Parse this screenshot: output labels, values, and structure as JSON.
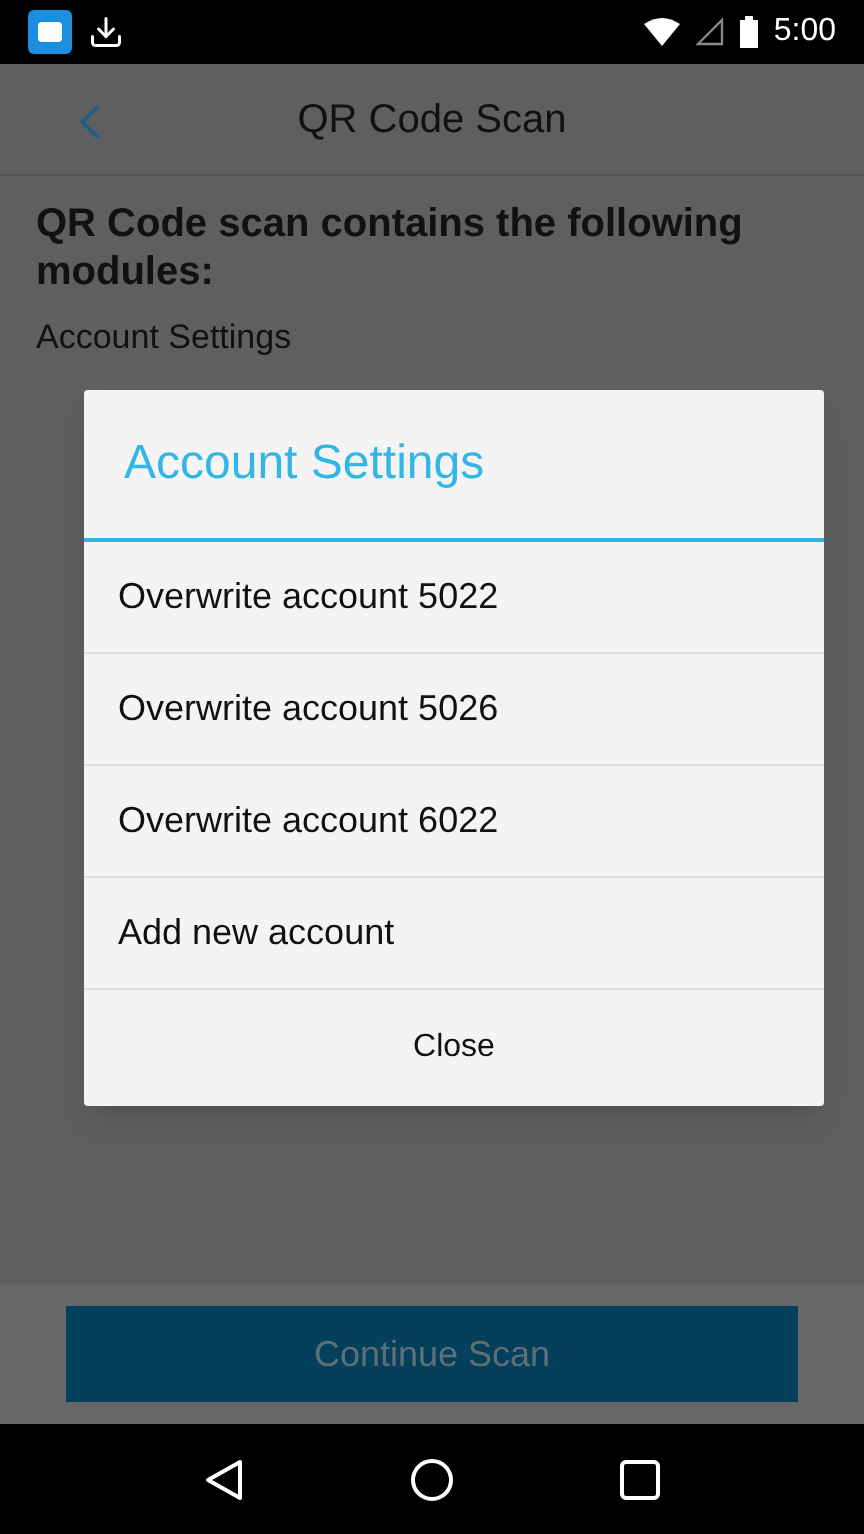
{
  "status_bar": {
    "time": "5:00"
  },
  "header": {
    "title": "QR Code Scan"
  },
  "content": {
    "heading": "QR Code scan contains the following modules:",
    "modules": [
      "Account Settings"
    ]
  },
  "dialog": {
    "title": "Account Settings",
    "options": [
      "Overwrite account 5022",
      "Overwrite account 5026",
      "Overwrite account 6022",
      "Add new account"
    ],
    "close": "Close"
  },
  "continue_button": {
    "label": "Continue Scan",
    "disabled": true
  }
}
